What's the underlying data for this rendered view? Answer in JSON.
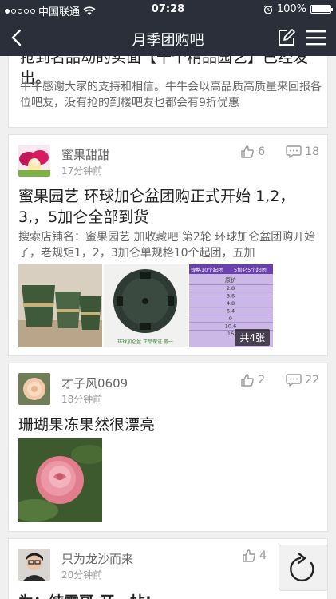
{
  "status_bar": {
    "carrier": "中国联通",
    "time": "07:28",
    "battery": "100%",
    "battery_level": 1.0,
    "signal_dots_filled": 1,
    "signal_dots_total": 5
  },
  "nav": {
    "title": "月季团购吧"
  },
  "posts": [
    {
      "title_partial": "抢到名品动的买面【十个精品园艺】已经发出。",
      "excerpt": "牛牛感谢大家的支持和相信。牛牛会以高品质高质量来回报各位吧友，没有抢的到楼吧友也都会有9折优惠"
    },
    {
      "author": "蜜果甜甜",
      "time": "17分钟前",
      "likes": "6",
      "comments": "18",
      "title": "蜜果园艺  环球加仑盆团购正式开始 1,2，3,，5加仑全部到货",
      "excerpt": "搜索店铺名：蜜果园艺 加收藏吧 第2轮 环球加仑盆团购开始了，老规矩1，2，3加仑单规格10个起团，五加",
      "image2_caption": "环球加仑盆  正品保证  假一",
      "table_header_1": "规格10个起团",
      "table_header_2": "5加仑5个起团",
      "table_col": "原价",
      "table_values": [
        "2.8",
        "3.6",
        "4.8",
        "6.4",
        "9",
        "10.6",
        "16"
      ],
      "more_images": "共4张"
    },
    {
      "author": "才子风0609",
      "time": "18分钟前",
      "likes": "2",
      "comments": "22",
      "title": "珊瑚果冻果然很漂亮"
    },
    {
      "author": "只为龙沙而来",
      "time": "20分钟前",
      "likes": "4",
      "title_partial": "为：纯露哥 开一帖!"
    }
  ],
  "colors": {
    "bar": "#2a2f3a",
    "card_bg": "#ffffff",
    "page_bg": "#f0f0f0",
    "meta_text": "#999999"
  },
  "icons": {
    "back": "chevron-left-icon",
    "edit": "compose-icon",
    "menu": "menu-icon",
    "like": "thumbs-up-icon",
    "comment": "comment-icon",
    "refresh": "refresh-icon"
  }
}
